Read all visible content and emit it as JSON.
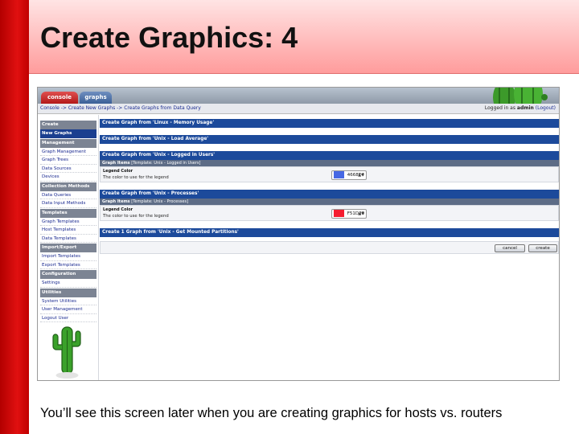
{
  "slide": {
    "title": "Create Graphics: 4",
    "caption": "You’ll see this screen later when you are creating graphics for hosts vs. routers"
  },
  "tabs": [
    {
      "label": "console"
    },
    {
      "label": "graphs"
    }
  ],
  "breadcrumb": {
    "text": "Console -> Create New Graphs -> Create Graphs from Data Query",
    "login_prefix": "Logged in as",
    "user": "admin",
    "logout": "(Logout)"
  },
  "sidebar": {
    "items": [
      {
        "label": "Create",
        "type": "head"
      },
      {
        "label": "New Graphs",
        "type": "active"
      },
      {
        "label": "Management",
        "type": "head"
      },
      {
        "label": "Graph Management",
        "type": "item"
      },
      {
        "label": "Graph Trees",
        "type": "item"
      },
      {
        "label": "Data Sources",
        "type": "item"
      },
      {
        "label": "Devices",
        "type": "item"
      },
      {
        "label": "Collection Methods",
        "type": "head"
      },
      {
        "label": "Data Queries",
        "type": "item"
      },
      {
        "label": "Data Input Methods",
        "type": "item"
      },
      {
        "label": "Templates",
        "type": "head"
      },
      {
        "label": "Graph Templates",
        "type": "item"
      },
      {
        "label": "Host Templates",
        "type": "item"
      },
      {
        "label": "Data Templates",
        "type": "item"
      },
      {
        "label": "Import/Export",
        "type": "head"
      },
      {
        "label": "Import Templates",
        "type": "item"
      },
      {
        "label": "Export Templates",
        "type": "item"
      },
      {
        "label": "Configuration",
        "type": "head"
      },
      {
        "label": "Settings",
        "type": "item"
      },
      {
        "label": "Utilities",
        "type": "head"
      },
      {
        "label": "System Utilities",
        "type": "item"
      },
      {
        "label": "User Management",
        "type": "item"
      },
      {
        "label": "Logout User",
        "type": "item"
      }
    ]
  },
  "main": {
    "sections": [
      {
        "header": "Create Graph from 'Linux - Memory Usage'"
      },
      {
        "header": "Create Graph from 'Unix - Load Average'"
      },
      {
        "header": "Create Graph from 'Unix - Logged in Users'",
        "sub_label": "Graph Items",
        "sub_text": "[Template: Unix - Logged in Users]",
        "legend_label": "Legend Color",
        "legend_desc": "The color to use for the legend",
        "color_value": "4668E4",
        "color_hex": "#4668E4"
      },
      {
        "header": "Create Graph from 'Unix - Processes'",
        "sub_label": "Graph Items",
        "sub_text": "[Template: Unix - Processes]",
        "legend_label": "Legend Color",
        "legend_desc": "The color to use for the legend",
        "color_value": "F51D30",
        "color_hex": "#F51D30"
      },
      {
        "header": "Create 1 Graph from 'Unix - Get Mounted Partitions'"
      }
    ],
    "buttons": {
      "cancel": "cancel",
      "create": "create"
    }
  },
  "colors": {
    "section_header": "#1c4a9b",
    "slide_accent": "#e01010",
    "title_band": "#ff9c9c"
  }
}
